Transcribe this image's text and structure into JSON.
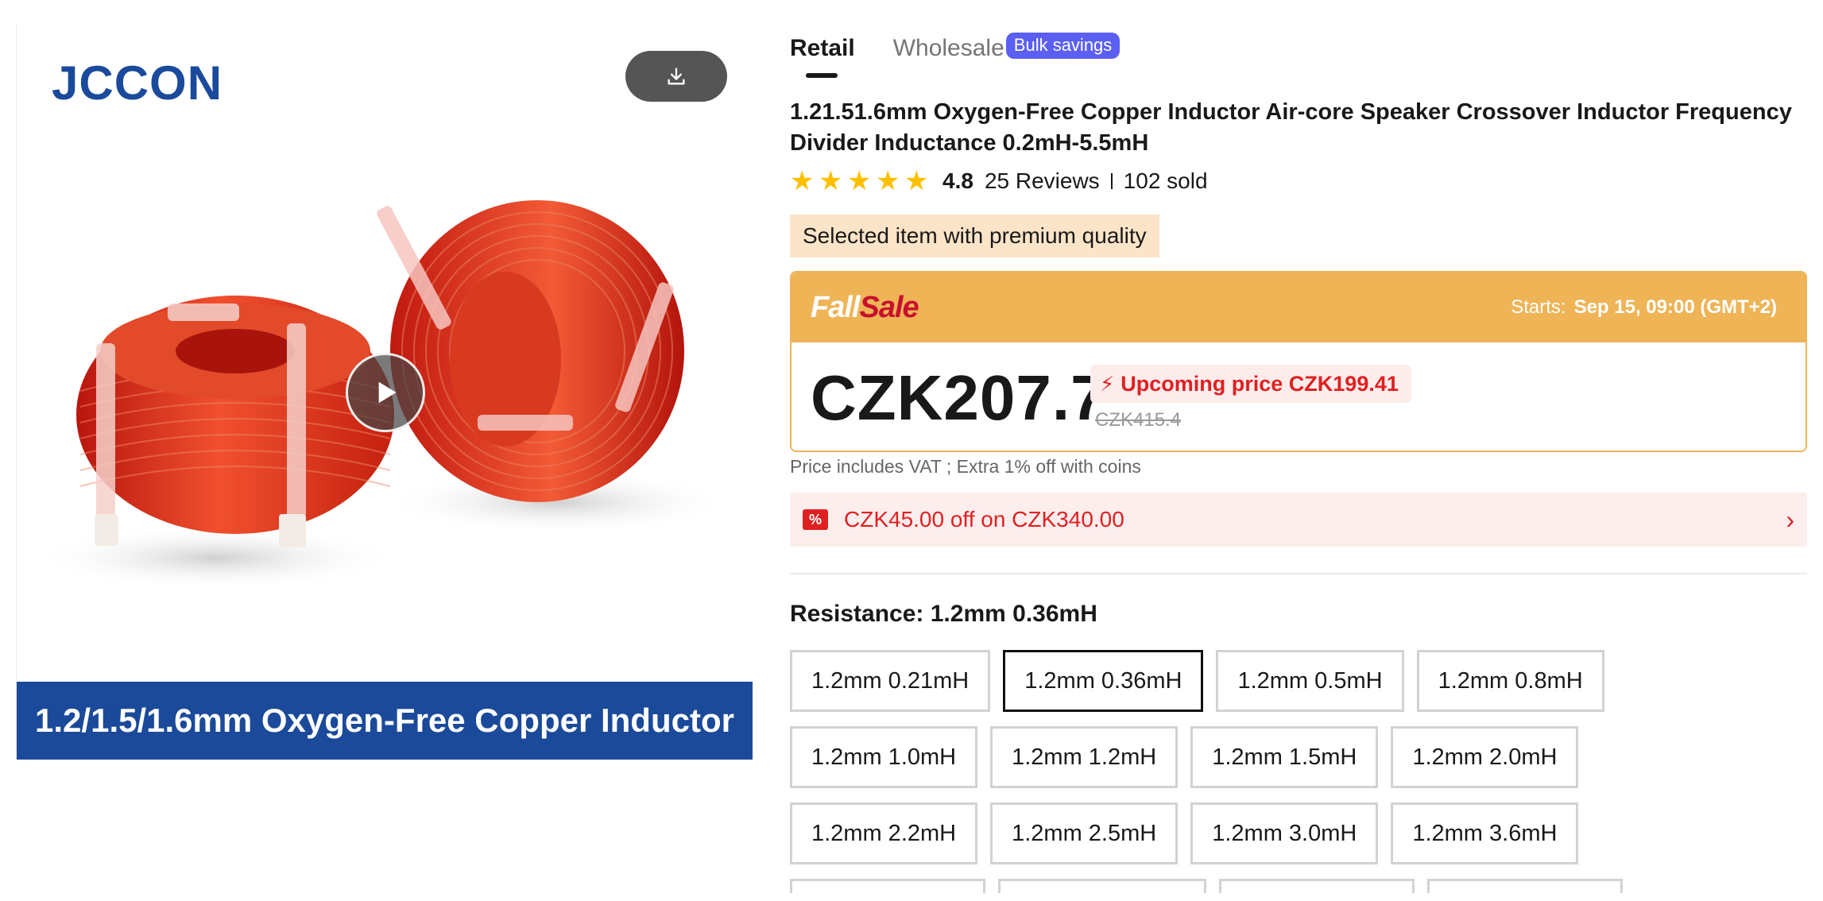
{
  "gallery": {
    "brand": "JCCON",
    "banner_text": "1.2/1.5/1.6mm Oxygen-Free Copper Inductor",
    "download_icon": "download-icon",
    "play_icon": "play-icon"
  },
  "tabs": {
    "retail": "Retail",
    "wholesale": "Wholesale",
    "bulk_badge": "Bulk savings"
  },
  "product": {
    "title": "1.21.51.6mm Oxygen-Free Copper Inductor Air-core Speaker Crossover Inductor Frequency Divider Inductance 0.2mH-5.5mH",
    "rating": "4.8",
    "rating_stars": 5,
    "reviews": "25 Reviews",
    "sold": "102 sold",
    "premium_tag": "Selected item with premium quality"
  },
  "sale": {
    "logo_white": "Fall",
    "logo_red": "Sale",
    "starts_label": "Starts:",
    "starts_value": "Sep 15, 09:00 (GMT+2)",
    "price": "CZK207.7",
    "upcoming": "Upcoming price CZK199.41",
    "old_price": "CZK415.4"
  },
  "vat_note": "Price includes VAT ; Extra 1% off with coins",
  "coupon": {
    "icon": "%",
    "text": "CZK45.00 off on CZK340.00"
  },
  "resistance": {
    "label": "Resistance: 1.2mm 0.36mH",
    "selected": "1.2mm 0.36mH",
    "rows": [
      [
        "1.2mm 0.21mH",
        "1.2mm 0.36mH",
        "1.2mm 0.5mH",
        "1.2mm 0.8mH"
      ],
      [
        "1.2mm 1.0mH",
        "1.2mm 1.2mH",
        "1.2mm 1.5mH",
        "1.2mm 2.0mH"
      ],
      [
        "1.2mm 2.2mH",
        "1.2mm 2.5mH",
        "1.2mm 3.0mH",
        "1.2mm 3.6mH"
      ]
    ]
  },
  "colors": {
    "brand_blue": "#1b4a9a",
    "sale_orange": "#eeb456",
    "price_red": "#e02020",
    "star": "#fdc000"
  }
}
